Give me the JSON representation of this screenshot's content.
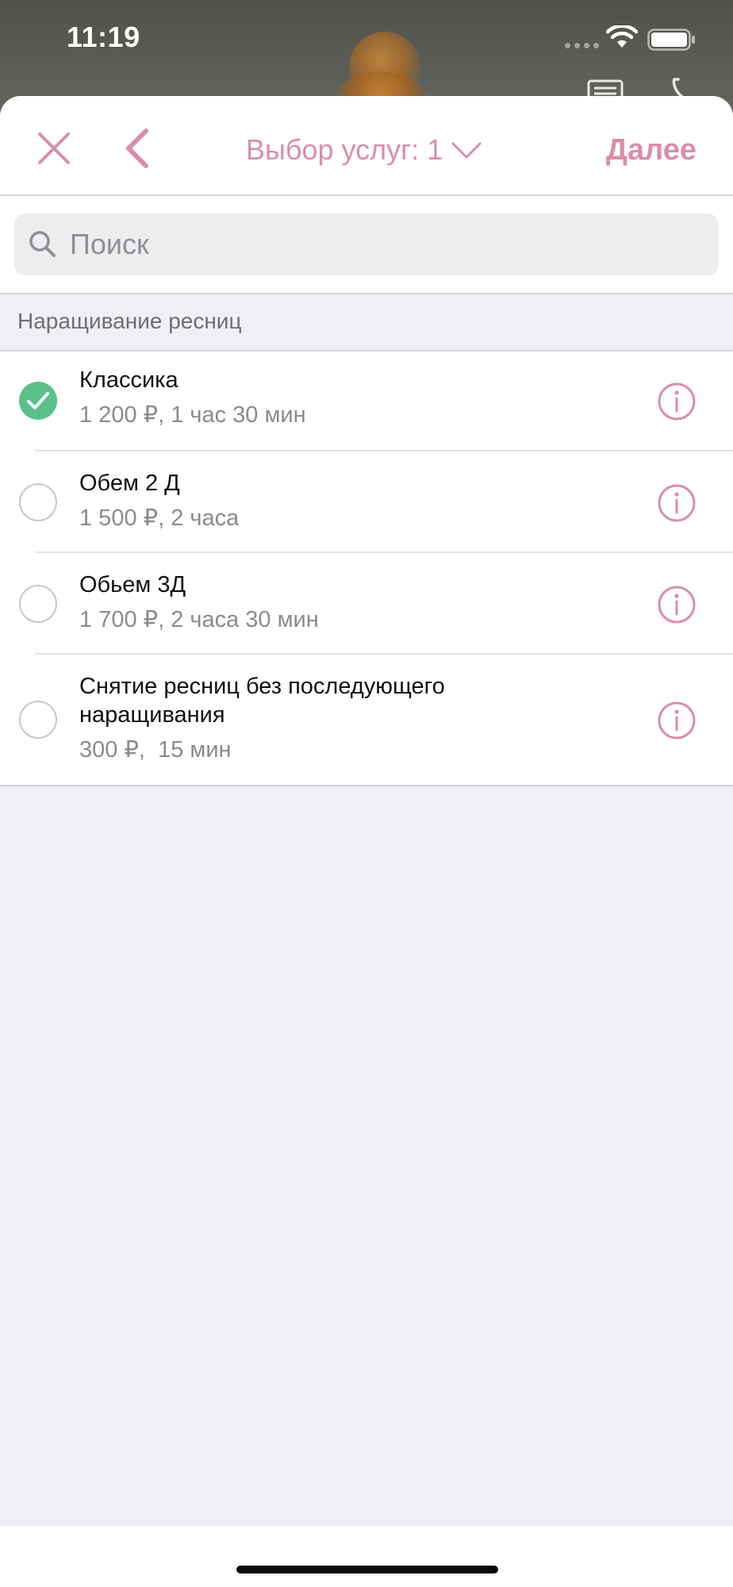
{
  "status_bar": {
    "time": "11:19"
  },
  "nav": {
    "title": "Выбор услуг: 1",
    "next_label": "Далее",
    "accent_color": "#d98ea8"
  },
  "search": {
    "placeholder": "Поиск",
    "value": ""
  },
  "section": {
    "title": "Наращивание ресниц"
  },
  "services": [
    {
      "title": "Классика",
      "subtitle": "1 200 ₽, 1 час 30 мин",
      "selected": true
    },
    {
      "title": "Обем 2 Д",
      "subtitle": "1 500 ₽, 2 часа",
      "selected": false
    },
    {
      "title": "Обьем 3Д",
      "subtitle": "1 700 ₽, 2 часа 30 мин",
      "selected": false
    },
    {
      "title": "Снятие ресниц без последующего наращивания",
      "subtitle": "300 ₽,  15 мин",
      "selected": false
    }
  ],
  "colors": {
    "selected_check": "#5cc08a",
    "secondary_text": "#8a8a8f"
  },
  "icons": {
    "close": "close-icon",
    "back": "chevron-left-icon",
    "title_dropdown": "chevron-down-icon",
    "search": "search-icon",
    "info": "info-icon",
    "check": "check-icon"
  }
}
